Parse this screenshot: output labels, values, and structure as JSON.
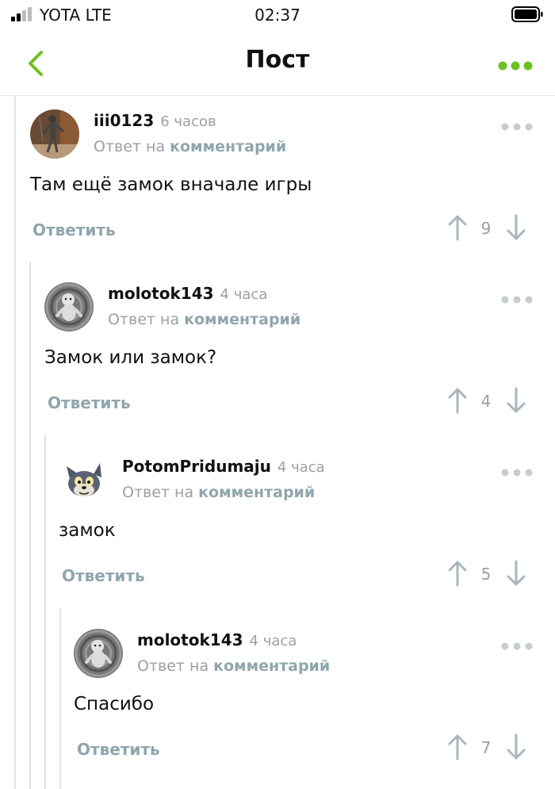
{
  "status_bar": {
    "carrier": "YOTA LTE",
    "time": "02:37"
  },
  "nav": {
    "title": "Пост"
  },
  "colors": {
    "accent": "#6cc11f",
    "muted": "#9aa0a3",
    "link": "#8fa6ad"
  },
  "comments": [
    {
      "username": "iii0123",
      "time": "6 часов",
      "reply_prefix": "Ответ на",
      "reply_link": "комментарий",
      "text": "Там ещё замок вначале игры",
      "reply_label": "Ответить",
      "score": "9",
      "avatar": "photo-avatar"
    },
    {
      "username": "molotok143",
      "time": "4 часа",
      "reply_prefix": "Ответ на",
      "reply_link": "комментарий",
      "text": "Замок или замок?",
      "reply_label": "Ответить",
      "score": "4",
      "avatar": "baby-avatar"
    },
    {
      "username": "PotomPridumaju",
      "time": "4 часа",
      "reply_prefix": "Ответ на",
      "reply_link": "комментарий",
      "text": "замок",
      "reply_label": "Ответить",
      "score": "5",
      "avatar": "cat-avatar"
    },
    {
      "username": "molotok143",
      "time": "4 часа",
      "reply_prefix": "Ответ на",
      "reply_link": "комментарий",
      "text": "Спасибо",
      "reply_label": "Ответить",
      "score": "7",
      "avatar": "baby-avatar"
    }
  ]
}
